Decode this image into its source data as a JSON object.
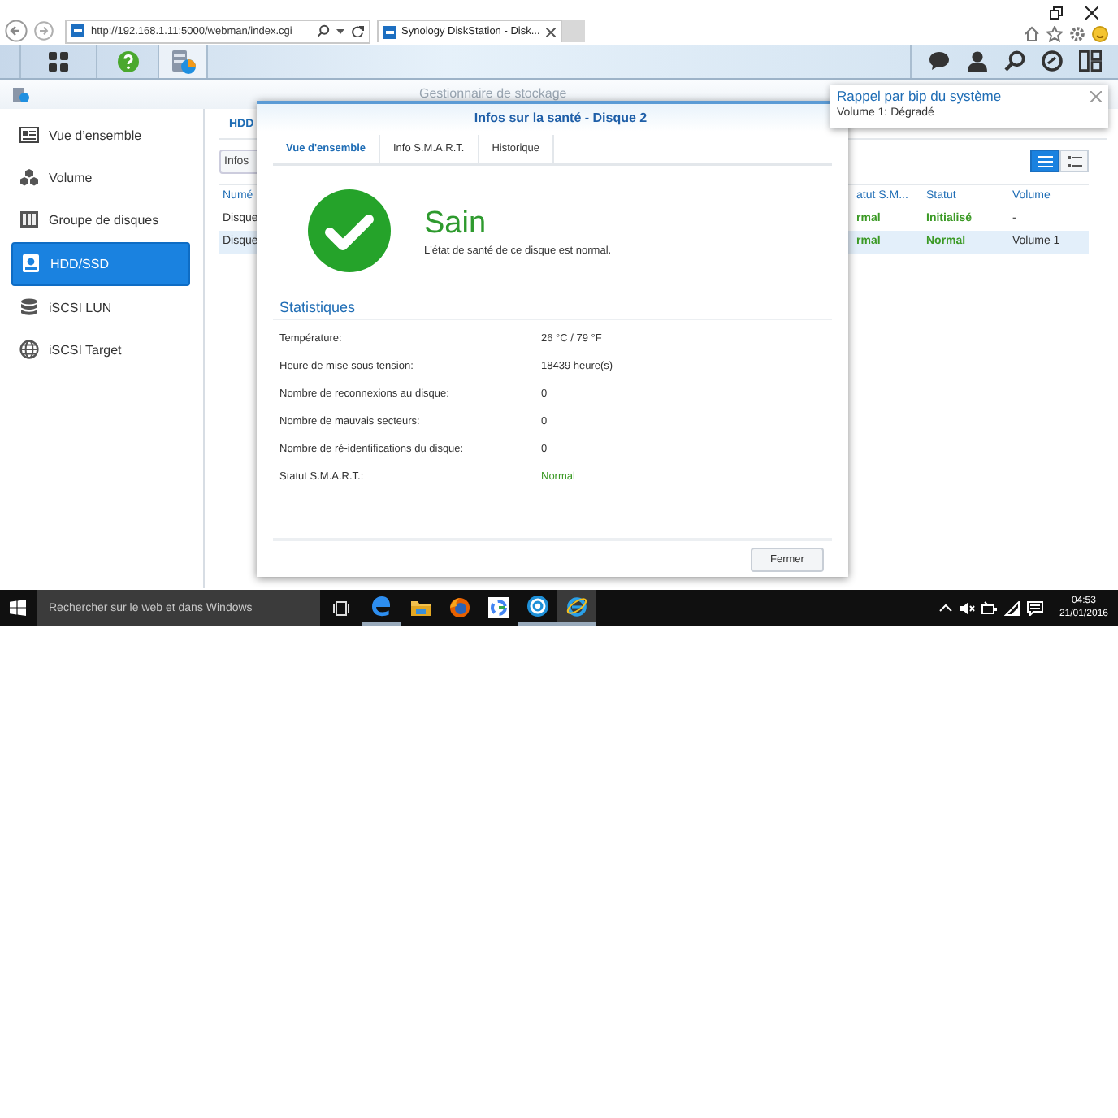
{
  "browser": {
    "address": "http://192.168.1.11:5000/webman/index.cgi",
    "tab": {
      "title": "Synology DiskStation - Disk..."
    }
  },
  "notification": {
    "title": "Rappel par bip du système",
    "message": "Volume 1: Dégradé"
  },
  "app_window": {
    "title": "Gestionnaire de stockage"
  },
  "sidebar": {
    "items": [
      {
        "label": "Vue d’ensemble",
        "selected": false
      },
      {
        "label": "Volume",
        "selected": false
      },
      {
        "label": "Groupe de disques",
        "selected": false
      },
      {
        "label": "HDD/SSD",
        "selected": true
      },
      {
        "label": "iSCSI LUN",
        "selected": false
      },
      {
        "label": "iSCSI Target",
        "selected": false
      }
    ]
  },
  "main": {
    "tab": "HDD",
    "button": "Infos",
    "view_toggles": [
      {
        "selected": true
      },
      {
        "selected": false
      }
    ],
    "columns": [
      {
        "label": "Numé",
        "kind": "text"
      },
      {
        "label": "atut S.M...",
        "kind": "status"
      },
      {
        "label": "Statut",
        "kind": "status"
      },
      {
        "label": "Volume",
        "kind": "text"
      }
    ],
    "rows": [
      {
        "cells": [
          "Disque",
          "rmal",
          "Initialisé",
          "-"
        ],
        "selected": false
      },
      {
        "cells": [
          "Disque",
          "rmal",
          "Normal",
          "Volume 1"
        ],
        "selected": true
      }
    ]
  },
  "dialog": {
    "title": "Infos sur la santé - Disque 2",
    "tabs": [
      {
        "label": "Vue d'ensemble",
        "selected": true
      },
      {
        "label": "Info S.M.A.R.T.",
        "selected": false
      },
      {
        "label": "Historique",
        "selected": false
      }
    ],
    "health": {
      "status": "Sain",
      "description": "L'état de santé de ce disque est normal."
    },
    "section": "Statistiques",
    "stats": [
      {
        "label": "Température:",
        "value": "26 °C / 79 °F",
        "kind": "text"
      },
      {
        "label": "Heure de mise sous tension:",
        "value": "18439 heure(s)",
        "kind": "text"
      },
      {
        "label": "Nombre de reconnexions au disque:",
        "value": "0",
        "kind": "text"
      },
      {
        "label": "Nombre de mauvais secteurs:",
        "value": "0",
        "kind": "text"
      },
      {
        "label": "Nombre de ré-identifications du disque:",
        "value": "0",
        "kind": "text"
      },
      {
        "label": "Statut S.M.A.R.T.:",
        "value": "Normal",
        "kind": "status"
      }
    ],
    "button": "Fermer"
  },
  "taskbar": {
    "search_placeholder": "Rechercher sur le web et dans Windows",
    "apps": [
      {
        "running": true,
        "selected": false
      },
      {
        "running": false,
        "selected": false
      },
      {
        "running": false,
        "selected": false
      },
      {
        "running": false,
        "selected": false
      },
      {
        "running": true,
        "selected": false
      },
      {
        "running": true,
        "selected": true
      }
    ],
    "time": "04:53",
    "date": "21/01/2016"
  }
}
